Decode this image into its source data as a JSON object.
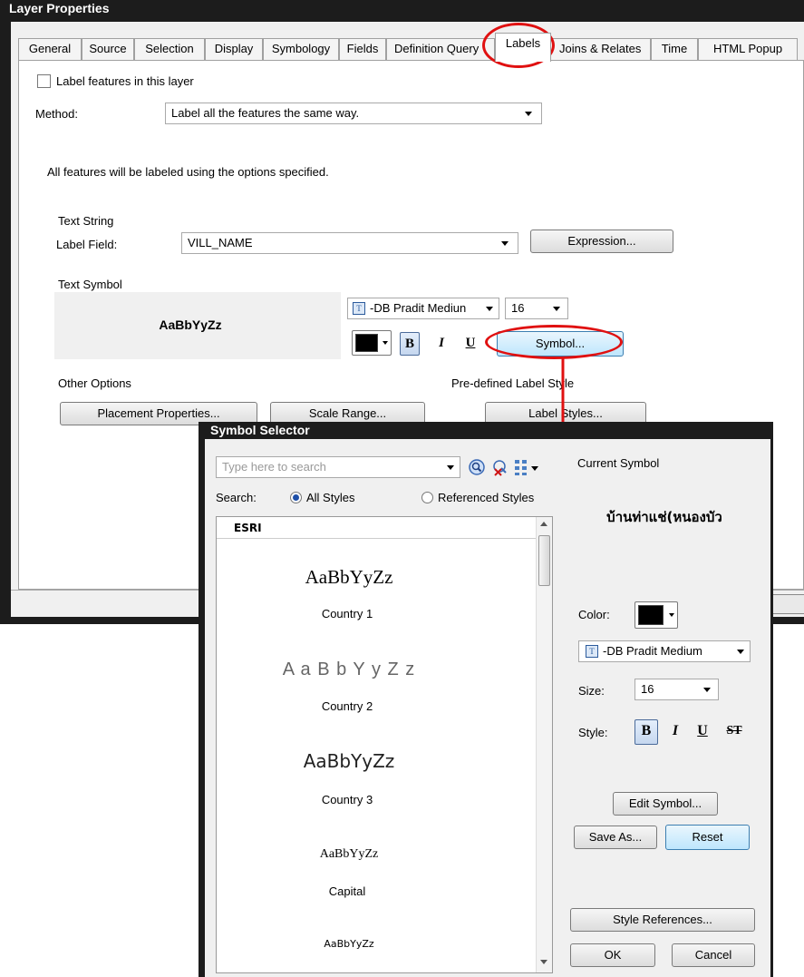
{
  "layer_properties": {
    "title": "Layer Properties",
    "tabs": [
      "General",
      "Source",
      "Selection",
      "Display",
      "Symbology",
      "Fields",
      "Definition Query",
      "Labels",
      "Joins & Relates",
      "Time",
      "HTML Popup"
    ],
    "active_tab": "Labels",
    "label_features_checkbox": "Label features in this layer",
    "method_label": "Method:",
    "method_value": "Label all the features the same way.",
    "info_text": "All features will be labeled using the options specified.",
    "text_string_heading": "Text String",
    "label_field_label": "Label Field:",
    "label_field_value": "VILL_NAME",
    "expression_button": "Expression...",
    "text_symbol_heading": "Text Symbol",
    "preview_text": "AaBbYyZz",
    "font_value": "-DB Pradit Mediun",
    "size_value": "16",
    "bold": "B",
    "italic": "I",
    "underline": "U",
    "symbol_button": "Symbol...",
    "other_options_heading": "Other Options",
    "predefined_heading": "Pre-defined Label Style",
    "placement_button": "Placement Properties...",
    "scale_button": "Scale Range...",
    "label_styles_button": "Label Styles..."
  },
  "symbol_selector": {
    "title": "Symbol Selector",
    "search_placeholder": "Type here to search",
    "search_label": "Search:",
    "all_styles": "All Styles",
    "referenced_styles": "Referenced Styles",
    "group_header": "ESRI",
    "symbols": [
      {
        "sample": "AaBbYyZz",
        "name": "Country 1"
      },
      {
        "sample": "A a B b Y y Z z",
        "name": "Country 2"
      },
      {
        "sample": "AaBbYyZz",
        "name": "Country 3"
      },
      {
        "sample": "AaBbYyZz",
        "name": "Capital"
      },
      {
        "sample": "AaBbYyZz",
        "name": ""
      }
    ],
    "current_symbol_label": "Current Symbol",
    "current_symbol_preview": "บ้านท่าแช่(หนองบัว",
    "color_label": "Color:",
    "font_value": "-DB Pradit Medium",
    "size_label": "Size:",
    "size_value": "16",
    "style_label": "Style:",
    "style_bold": "B",
    "style_italic": "I",
    "style_underline": "U",
    "style_strike": "ST",
    "edit_symbol_button": "Edit Symbol...",
    "save_as_button": "Save As...",
    "reset_button": "Reset",
    "style_references_button": "Style References...",
    "ok_button": "OK",
    "cancel_button": "Cancel"
  },
  "colors": {
    "annotation_red": "#e01010",
    "symbol_color": "#000000",
    "radio_selected": "#1e4fa8"
  }
}
